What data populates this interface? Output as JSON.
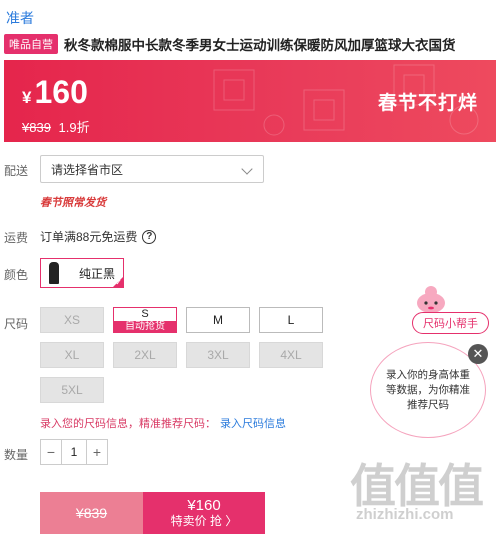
{
  "header": {
    "brand": "准者",
    "tag": "唯品自营",
    "title": "秋冬款棉服中长款冬季男女士运动训练保暖防风加厚篮球大衣国货"
  },
  "price": {
    "currency": "¥",
    "current": "160",
    "original": "¥839",
    "discount": "1.9折",
    "promo": "春节不打烊"
  },
  "shipping": {
    "label": "配送",
    "select_placeholder": "请选择省市区",
    "festival_note": "春节照常发货"
  },
  "freight": {
    "label": "运费",
    "text": "订单满88元免运费",
    "help_icon": "?"
  },
  "color": {
    "label": "颜色",
    "selected": "纯正黑"
  },
  "size": {
    "label": "尺码",
    "options": [
      {
        "name": "XS",
        "state": "disabled"
      },
      {
        "name": "S",
        "state": "selected",
        "badge": "自动抢货"
      },
      {
        "name": "M",
        "state": "available"
      },
      {
        "name": "L",
        "state": "available"
      },
      {
        "name": "XL",
        "state": "disabled"
      },
      {
        "name": "2XL",
        "state": "disabled"
      },
      {
        "name": "3XL",
        "state": "disabled"
      },
      {
        "name": "4XL",
        "state": "disabled"
      },
      {
        "name": "5XL",
        "state": "disabled"
      }
    ],
    "tip": "录入您的尺码信息，精准推荐尺码：",
    "tip_link": "录入尺码信息"
  },
  "quantity": {
    "label": "数量",
    "minus": "−",
    "value": "1",
    "plus": "+"
  },
  "buy": {
    "original": "¥839",
    "price": "¥160",
    "cta": "特卖价 抢 〉"
  },
  "helper": {
    "pill": "尺码小帮手",
    "bubble": "录入你的身高体重等数据，为你精准推荐尺码",
    "close": "✕"
  },
  "watermark": {
    "chars": "值值值",
    "url": "zhizhizhi.com"
  },
  "colors": {
    "brand_pink": "#e5306c",
    "banner_red": "#e5254c",
    "link_blue": "#2b7bdc"
  }
}
